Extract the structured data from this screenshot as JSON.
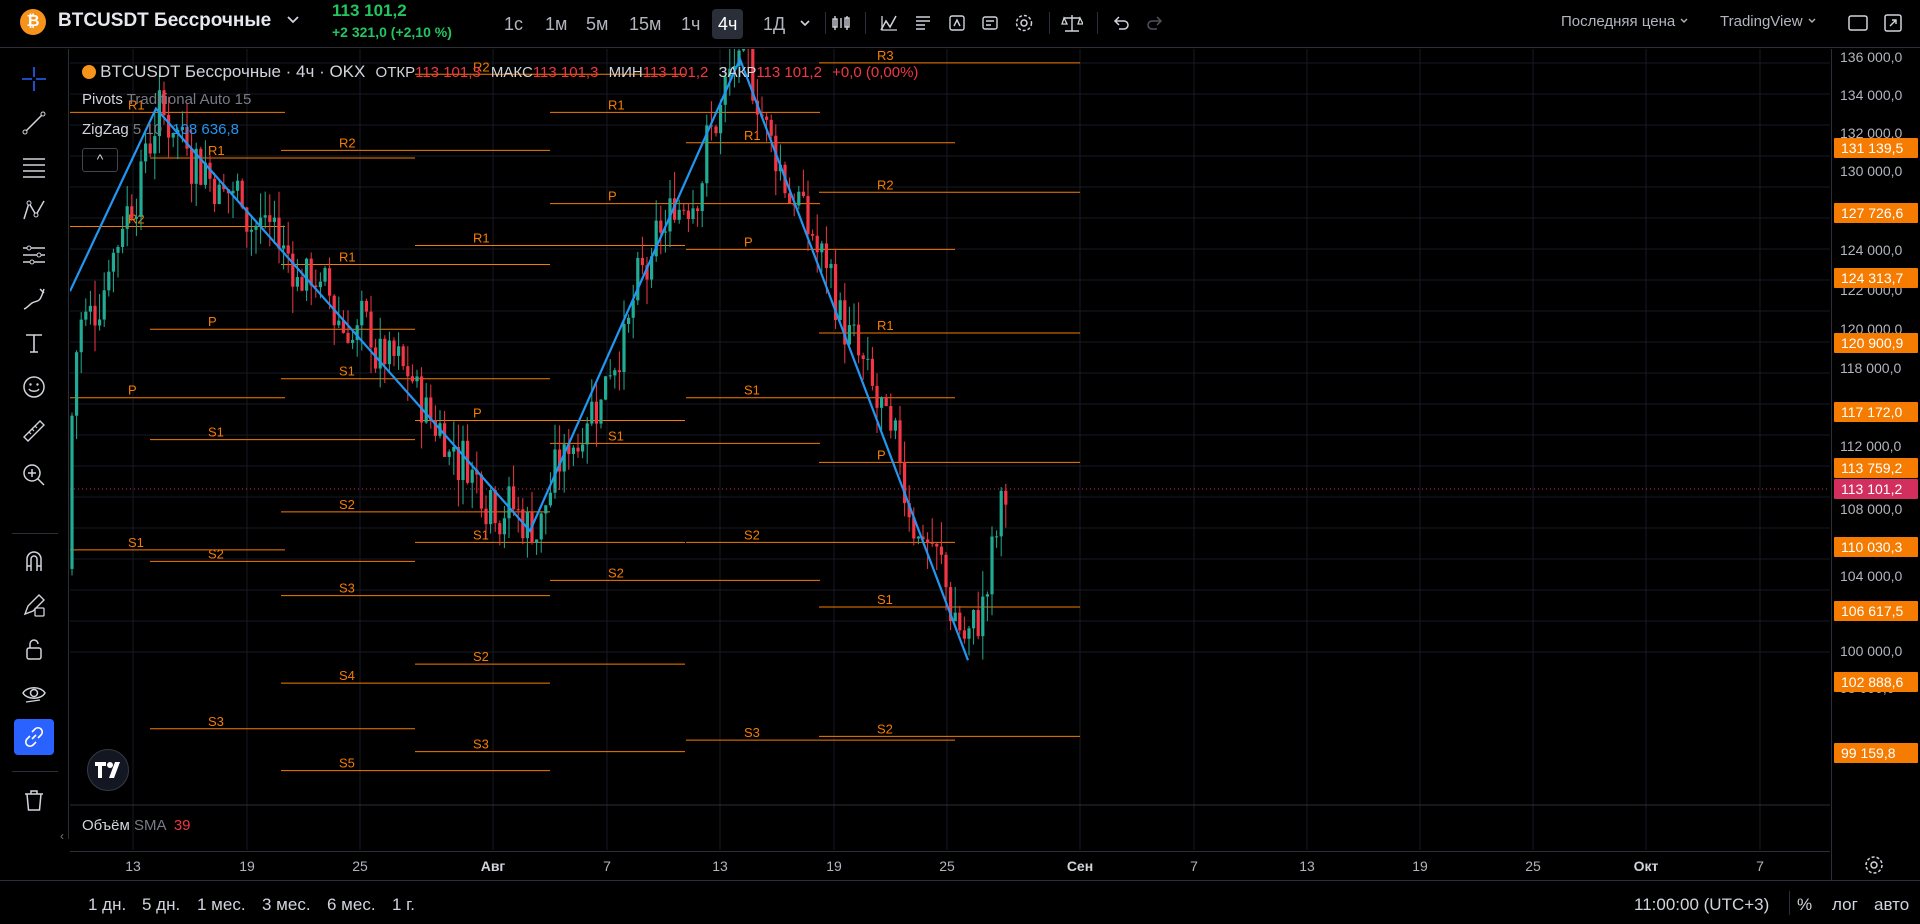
{
  "header": {
    "symbol_icon": "₿",
    "symbol": "BTCUSDT Бессрочные",
    "price": "113 101,2",
    "change": "+2 321,0 (+2,10 %)",
    "timeframes": [
      "1с",
      "1м",
      "5м",
      "15м",
      "1ч",
      "4ч",
      "1Д"
    ],
    "active_timeframe": "4ч",
    "price_type": "Последняя цена",
    "provider": "TradingView"
  },
  "legend": {
    "title": "BTCUSDT Бессрочные · 4ч · OKX",
    "o_label": "ОТКР",
    "o": "113 101,3",
    "h_label": "МАКС",
    "h": "113 101,3",
    "l_label": "МИН",
    "l": "113 101,2",
    "c_label": "ЗАКР",
    "c": "113 101,2",
    "chg": "+0,0 (0,00%)",
    "pivots_name": "Pivots",
    "pivots_params": "Traditional Auto 15",
    "zigzag_name": "ZigZag",
    "zigzag_params": "5 10",
    "zigzag_value": "108 636,8",
    "collapse": "^",
    "volume_name": "Объём",
    "volume_ma": "SMA",
    "volume_value": "39"
  },
  "chart_data": {
    "type": "candlestick",
    "timeframe": "4h",
    "last_price": 113101.2,
    "y_axis_ticks": [
      "136 000,0",
      "134 000,0",
      "132 000,0",
      "130 000,0",
      "126 000,0",
      "124 000,0",
      "122 000,0",
      "120 000,0",
      "118 000,0",
      "116 000,0",
      "112 000,0",
      "108 000,0",
      "104 000,0",
      "102 000,0",
      "100 000,0",
      "98 000,0"
    ],
    "price_labels": [
      {
        "value": "131 139,5",
        "kind": "pivot"
      },
      {
        "value": "127 726,6",
        "kind": "pivot"
      },
      {
        "value": "124 313,7",
        "kind": "pivot"
      },
      {
        "value": "120 900,9",
        "kind": "pivot"
      },
      {
        "value": "117 172,0",
        "kind": "pivot"
      },
      {
        "value": "113 759,2",
        "kind": "pivot"
      },
      {
        "value": "113 101,2",
        "kind": "last"
      },
      {
        "value": "110 030,3",
        "kind": "pivot"
      },
      {
        "value": "106 617,5",
        "kind": "pivot"
      },
      {
        "value": "102 888,6",
        "kind": "pivot"
      },
      {
        "value": "99 159,8",
        "kind": "pivot"
      }
    ],
    "x_axis_ticks": [
      "13",
      "19",
      "25",
      "Авг",
      "7",
      "13",
      "19",
      "25",
      "Сен",
      "7",
      "13",
      "19",
      "25",
      "Окт",
      "7"
    ],
    "zigzag": [
      {
        "date": "Jul 11",
        "price": 118300
      },
      {
        "date": "Jul 14",
        "price": 123100
      },
      {
        "date": "Aug 2",
        "price": 112000
      },
      {
        "date": "Aug 14",
        "price": 124400
      },
      {
        "date": "Aug 26",
        "price": 108600
      }
    ],
    "pivot_sets": [
      {
        "period": "1",
        "R1": 123000,
        "R2": 120000,
        "P": 115500,
        "S1": 111500,
        "S2": 102500,
        "S3": 98500
      },
      {
        "period": "2",
        "R4": 132000,
        "R3": 129100,
        "R2": 125600,
        "R1": 121800,
        "P": 117300,
        "S1": 114400,
        "S2": 111200,
        "S3": 106800,
        "S4": 102700,
        "S5": 98000
      },
      {
        "period": "3",
        "R5": 134500,
        "R4": 128600,
        "R3": 125500,
        "R2": 122000,
        "R1": 119000,
        "S1": 116000,
        "S2": 112500,
        "S3": 110300,
        "S4": 108000,
        "S5": 105700
      },
      {
        "period": "4",
        "R5": 133700,
        "R4": 131000,
        "R3": 127500,
        "R2": 124000,
        "R1": 119500,
        "P": 114900,
        "S1": 111700,
        "S2": 108500,
        "S3": 106200,
        "S4": 103800,
        "S5": 99400
      },
      {
        "period": "5",
        "R4": 131400,
        "R3": 128800,
        "R2": 126000,
        "R1": 123000,
        "P": 120600,
        "S1": 114300,
        "S2": 110700,
        "S3": 104000,
        "S4": 101800,
        "S5": 99500
      },
      {
        "period": "6",
        "R5": 135500,
        "R4": 132600,
        "R3": 129800,
        "R2": 127000,
        "R1": 122200,
        "P": 119400,
        "S1": 115500,
        "S2": 111700,
        "S3": 106500,
        "S4": 102900,
        "S5": 97800
      },
      {
        "period": "7",
        "R5": 131100,
        "R4": 127700,
        "R3": 124300,
        "R2": 120900,
        "R1": 117200,
        "P": 113800,
        "S1": 110000,
        "S2": 106600,
        "S3": 102900,
        "S4": 99200
      }
    ]
  },
  "bottom": {
    "ranges": [
      "1 дн.",
      "5 дн.",
      "1 мес.",
      "3 мес.",
      "6 мес.",
      "1 г."
    ],
    "time": "11:00:00 (UTC+3)",
    "percent": "%",
    "log": "лог",
    "auto": "авто"
  },
  "colors": {
    "bg": "#000000",
    "accent": "#2962ff",
    "up": "#22ab94",
    "down": "#f23645",
    "pivot": "#f57c00",
    "zigzag": "#2196f3",
    "last": "#d32f5e"
  }
}
